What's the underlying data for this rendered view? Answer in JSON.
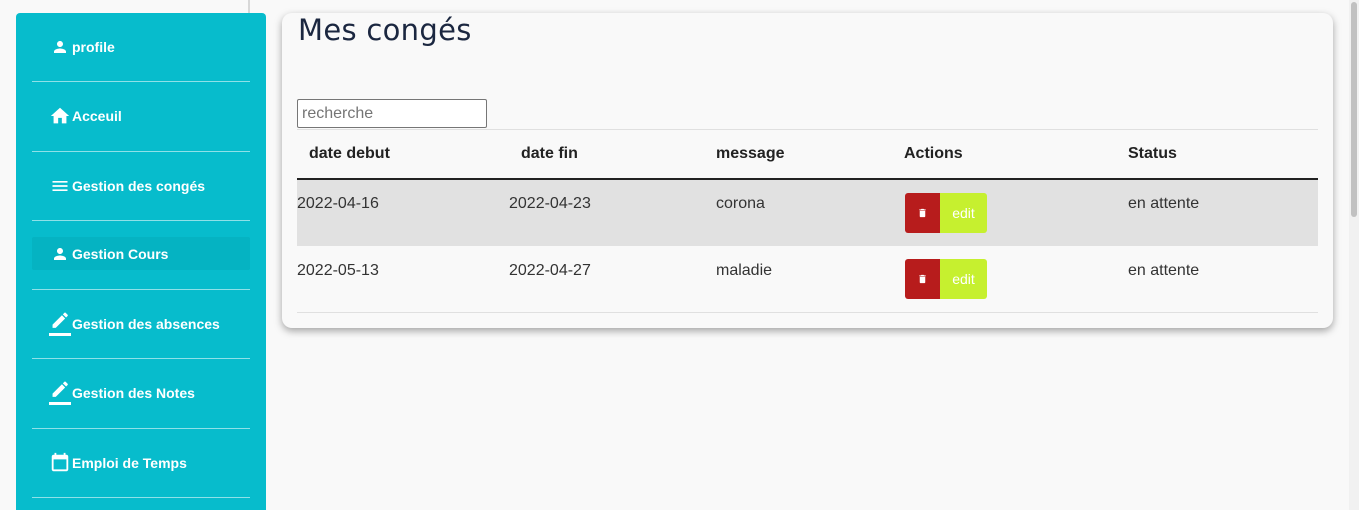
{
  "sidebar": {
    "items": [
      {
        "label": "profile",
        "icon": "person-icon"
      },
      {
        "label": "Acceuil",
        "icon": "home-icon"
      },
      {
        "label": "Gestion des congés",
        "icon": "menu-icon"
      },
      {
        "label": "Gestion Cours",
        "icon": "person-icon",
        "active": true
      },
      {
        "label": "Gestion des absences",
        "icon": "pencil-icon"
      },
      {
        "label": "Gestion des Notes",
        "icon": "pencil-icon"
      },
      {
        "label": "Emploi de Temps",
        "icon": "calendar-icon"
      }
    ]
  },
  "main": {
    "title": "Mes congés",
    "search": {
      "placeholder": "recherche",
      "value": ""
    },
    "table": {
      "headers": {
        "start": "date debut",
        "end": "date fin",
        "message": "message",
        "actions": "Actions",
        "status": "Status"
      },
      "rows": [
        {
          "start": "2022-04-16",
          "end": "2022-04-23",
          "message": "corona",
          "status": "en attente",
          "delete_icon": "trash-icon",
          "edit_label": "edit"
        },
        {
          "start": "2022-05-13",
          "end": "2022-04-27",
          "message": "maladie",
          "status": "en attente",
          "delete_icon": "trash-icon",
          "edit_label": "edit"
        }
      ]
    }
  },
  "colors": {
    "sidebar": "#07bccc",
    "delete_button": "#b71c1c",
    "edit_button": "#c6f02f",
    "title_text": "#1b2740"
  }
}
